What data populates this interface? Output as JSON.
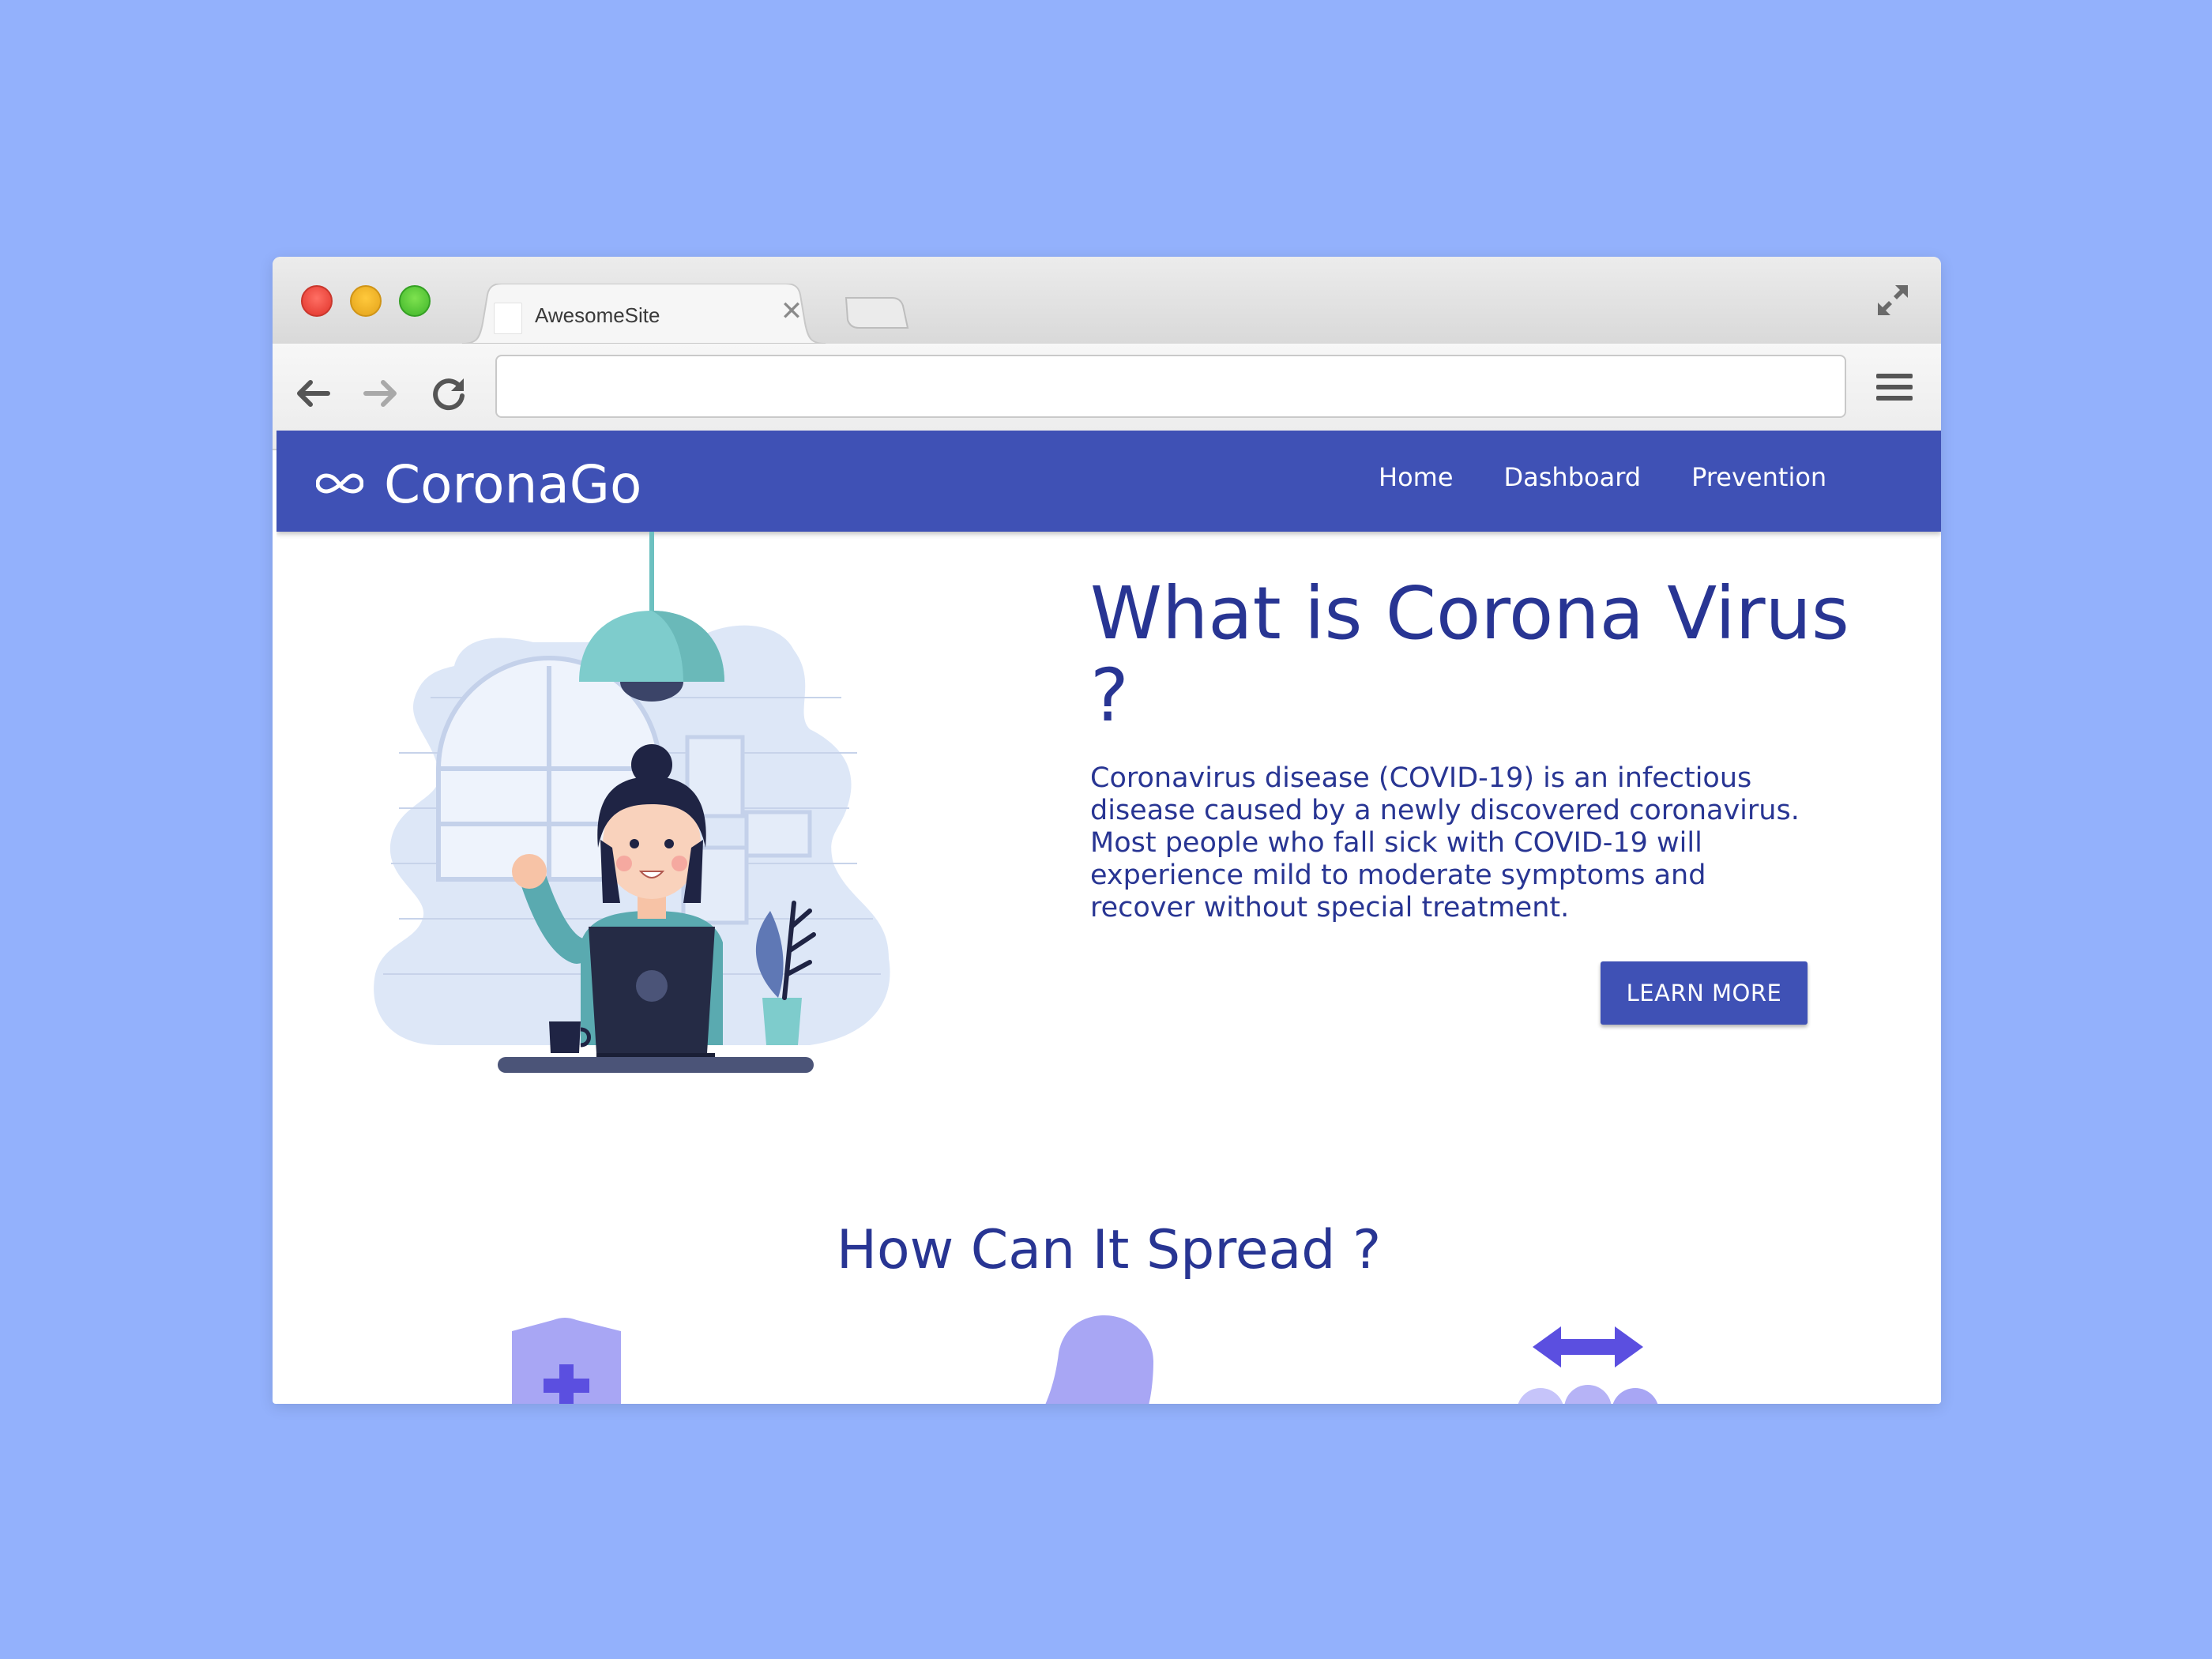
{
  "browser": {
    "tab_title": "AwesomeSite",
    "tab_close": "✕",
    "address_value": ""
  },
  "site": {
    "brand": "CoronaGo",
    "nav": [
      "Home",
      "Dashboard",
      "Prevention"
    ],
    "hero": {
      "title": "What is Corona Virus ?",
      "description": "Coronavirus disease (COVID-19) is an infectious disease caused by a newly discovered coronavirus. Most people who fall sick with COVID-19 will experience mild to moderate symptoms and recover without special treatment.",
      "button": "LEARN MORE"
    },
    "spread_title": "How Can It Spread ?"
  },
  "icons": {
    "brand": "infinity-icon",
    "spread": [
      "medical-shield-icon",
      "person-bubble-icon",
      "people-transfer-icon"
    ]
  },
  "colors": {
    "page_background": "#93b1fc",
    "navbar": "#3f51b5",
    "heading_text": "#283593",
    "accent_icon": "#a8a6f4"
  }
}
